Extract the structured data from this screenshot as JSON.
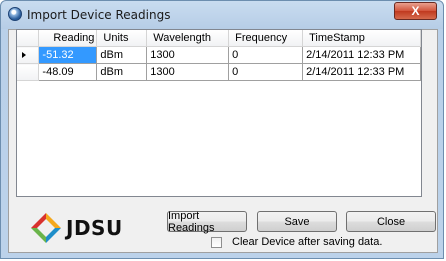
{
  "window": {
    "title": "Import Device Readings",
    "close_label": "X"
  },
  "grid": {
    "columns": [
      "Reading",
      "Units",
      "Wavelength",
      "Frequency",
      "TimeStamp"
    ],
    "rows": [
      {
        "cells": [
          "-51.32",
          "dBm",
          "1300",
          "0",
          "2/14/2011 12:33 PM"
        ],
        "current": true,
        "selected_cell": 0
      },
      {
        "cells": [
          "-48.09",
          "dBm",
          "1300",
          "0",
          "2/14/2011 12:33 PM"
        ],
        "current": false
      }
    ]
  },
  "logo": {
    "text": "JDSU",
    "colors": [
      "#f4a81d",
      "#1f8ec9",
      "#6ab44a",
      "#d8322e"
    ]
  },
  "buttons": {
    "import_label": "Import Readings",
    "save_label": "Save",
    "close_label": "Close"
  },
  "clear_device": {
    "label": "Clear Device after saving data.",
    "checked": false
  },
  "colors": {
    "selection": "#3399ff",
    "window_frame": "#b9d0e9",
    "close_button": "#c0391f"
  }
}
